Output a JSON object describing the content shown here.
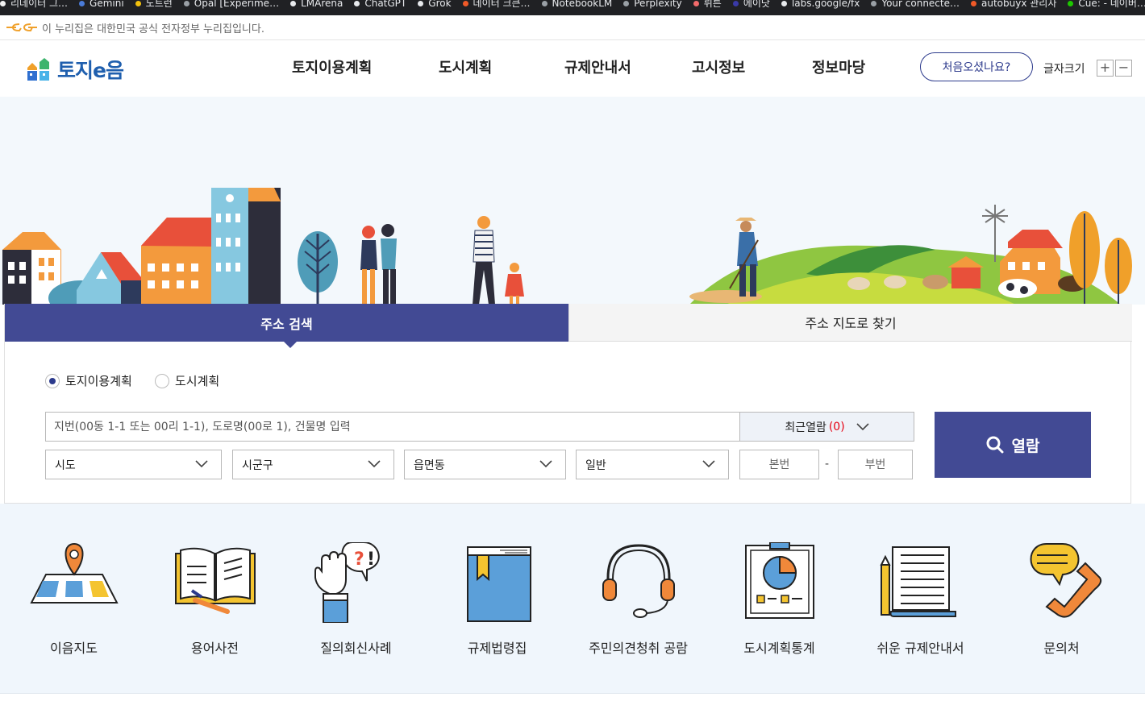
{
  "bookmarks": [
    {
      "label": "리데이터 그…",
      "color": "#f2f2f2"
    },
    {
      "label": "Gemini",
      "color": "#4a7bd8"
    },
    {
      "label": "노트런",
      "color": "#f4c20d"
    },
    {
      "label": "Opal [Experime…",
      "color": "#9aa0a6"
    },
    {
      "label": "LMArena",
      "color": "#e8eaed"
    },
    {
      "label": "ChatGPT",
      "color": "#e8eaed"
    },
    {
      "label": "Grok",
      "color": "#e8eaed"
    },
    {
      "label": "데이터 크큰…",
      "color": "#f05a28"
    },
    {
      "label": "NotebookLM",
      "color": "#9aa0a6"
    },
    {
      "label": "Perplexity",
      "color": "#9aa0a6"
    },
    {
      "label": "뤼튼",
      "color": "#f26b6b"
    },
    {
      "label": "에이닷",
      "color": "#3a3aa8"
    },
    {
      "label": "labs.google/fx",
      "color": "#e8eaed"
    },
    {
      "label": "Your connecte…",
      "color": "#9aa0a6"
    },
    {
      "label": "autobuyx 관리자",
      "color": "#f05a28"
    },
    {
      "label": "Cue: - 네이버…",
      "color": "#1ec800"
    }
  ],
  "gov_banner": {
    "text": "이 누리집은 대한민국 공식 전자정부 누리집입니다."
  },
  "logo": {
    "text": "토지e음"
  },
  "nav": [
    "토지이용계획",
    "도시계획",
    "규제안내서",
    "고시정보",
    "정보마당"
  ],
  "header": {
    "first_visit": "처음오셨나요?",
    "font_size_label": "글자크기",
    "plus": "+",
    "minus": "−"
  },
  "tabs": {
    "address_search": "주소 검색",
    "map_search": "주소 지도로 찾기"
  },
  "radios": {
    "land_use": "토지이용계획",
    "urban": "도시계획",
    "selected": "토지이용계획"
  },
  "search": {
    "placeholder": "지번(00동 1-1 또는 00리 1-1), 도로명(00로 1), 건물명 입력",
    "recent_label": "최근열람",
    "recent_count": "(0)",
    "sido": "시도",
    "sigungu": "시군구",
    "eupmyeondong": "읍면동",
    "type": "일반",
    "main_no_placeholder": "본번",
    "sub_no_placeholder": "부번",
    "dash": "-",
    "view_button": "열람"
  },
  "quick_menu": [
    {
      "label": "이음지도",
      "icon": "map-pin-icon"
    },
    {
      "label": "용어사전",
      "icon": "open-book-icon"
    },
    {
      "label": "질의회신사례",
      "icon": "hand-question-icon"
    },
    {
      "label": "규제법령집",
      "icon": "law-book-icon"
    },
    {
      "label": "주민의견청취 공람",
      "icon": "headset-icon"
    },
    {
      "label": "도시계획통계",
      "icon": "chart-board-icon"
    },
    {
      "label": "쉬운 규제안내서",
      "icon": "document-pencil-icon"
    },
    {
      "label": "문의처",
      "icon": "phone-chat-icon"
    }
  ],
  "colors": {
    "primary": "#424a94",
    "accent_red": "#e60012",
    "logo_blue": "#1f5fae"
  }
}
